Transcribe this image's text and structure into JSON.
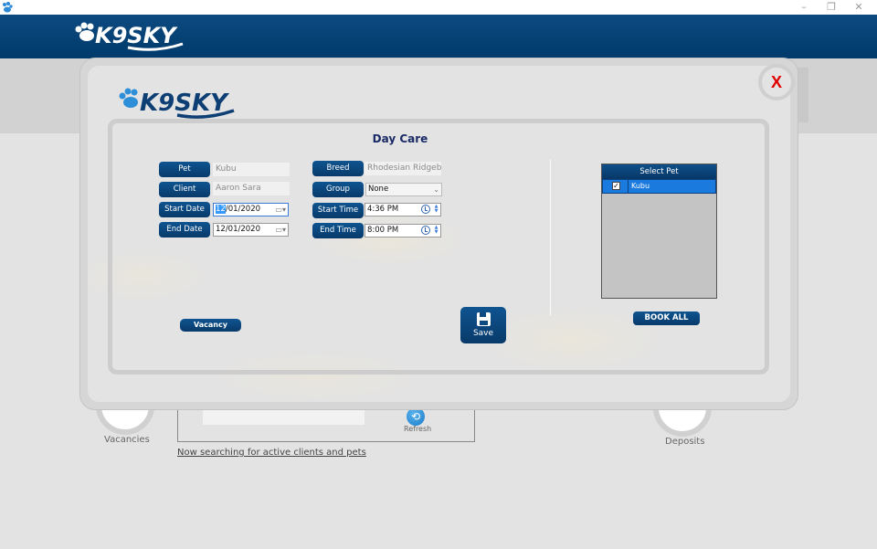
{
  "window": {
    "minimize": "–",
    "restore": "❐",
    "close": "✕"
  },
  "brand": {
    "logo_text": "K9SKY"
  },
  "background": {
    "vacancies_label": "Vacancies",
    "deposits_label": "Deposits",
    "refresh_label": "Refresh",
    "status_link": "Now searching for active clients and pets"
  },
  "modal": {
    "close_label": "X",
    "title": "Day Care",
    "fields": {
      "pet_label": "Pet",
      "pet_value": "Kubu",
      "client_label": "Client",
      "client_value": "Aaron Sara",
      "start_date_label": "Start Date",
      "start_date_month": "12",
      "start_date_rest": "/01/2020",
      "end_date_label": "End Date",
      "end_date_value": "12/01/2020",
      "breed_label": "Breed",
      "breed_value": "Rhodesian Ridgeback",
      "group_label": "Group",
      "group_value": "None",
      "start_time_label": "Start Time",
      "start_time_value": "4:36 PM",
      "end_time_label": "End Time",
      "end_time_value": "8:00 PM"
    },
    "pet_list": {
      "header": "Select Pet",
      "items": [
        {
          "name": "Kubu",
          "checked": true,
          "check_glyph": "✓"
        }
      ]
    },
    "buttons": {
      "vacancy": "Vacancy",
      "save": "Save",
      "book_all": "BOOK ALL"
    }
  }
}
